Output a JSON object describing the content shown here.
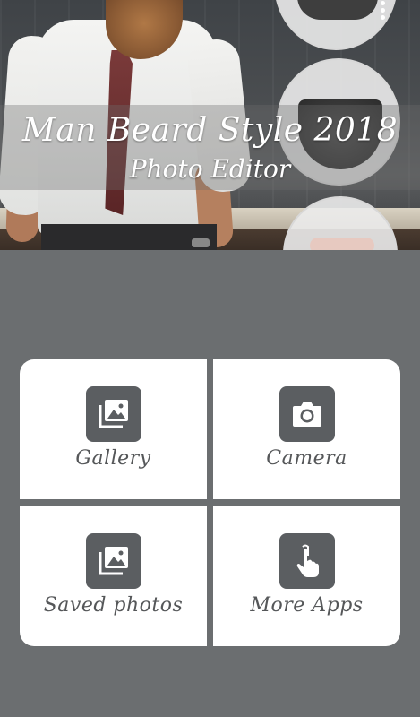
{
  "banner": {
    "title": "Man Beard Style 2018",
    "subtitle": "Photo Editor"
  },
  "menu": {
    "items": [
      {
        "label": "Gallery",
        "icon": "gallery-icon"
      },
      {
        "label": "Camera",
        "icon": "camera-icon"
      },
      {
        "label": "Saved photos",
        "icon": "saved-photos-icon"
      },
      {
        "label": "More Apps",
        "icon": "touch-icon"
      }
    ]
  },
  "colors": {
    "background": "#6b6e70",
    "tile": "#ffffff",
    "icon_bg": "#5b5e61",
    "label": "#555759"
  }
}
